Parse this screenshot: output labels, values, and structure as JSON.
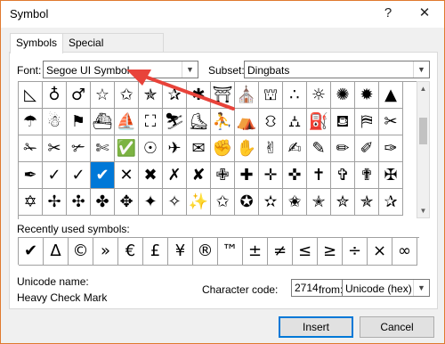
{
  "window": {
    "title": "Symbol",
    "help": "?",
    "close": "✕"
  },
  "tabs": [
    {
      "label": "Symbols",
      "active": true
    },
    {
      "label": "Special Characters",
      "active": false
    }
  ],
  "font": {
    "label": "Font:",
    "value": "Segoe UI Symbol"
  },
  "subset": {
    "label": "Subset:",
    "value": "Dingbats"
  },
  "symbols": [
    [
      "◺",
      "♁",
      "♂",
      "☆",
      "✩",
      "✯",
      "✰",
      "✱",
      "⛩",
      "⛪",
      "⛫",
      "∴",
      "☼",
      "✺",
      "✹",
      "▲"
    ],
    [
      "☂",
      "☃",
      "⚑",
      "⛴",
      "⛵",
      "⛶",
      "⛷",
      "⛸",
      "⛹",
      "⛺",
      "⛻",
      "⛼",
      "⛽",
      "⛾",
      "⛿",
      "✂"
    ],
    [
      "✁",
      "✂",
      "✃",
      "✄",
      "✅",
      "☉",
      "✈",
      "✉",
      "✊",
      "✋",
      "✌",
      "✍",
      "✎",
      "✏",
      "✐",
      "✑"
    ],
    [
      "✒",
      "✓",
      "✓",
      "✔",
      "✕",
      "✖",
      "✗",
      "✘",
      "✙",
      "✚",
      "✛",
      "✜",
      "✝",
      "✞",
      "✟",
      "✠"
    ],
    [
      "✡",
      "✢",
      "✣",
      "✤",
      "✥",
      "✦",
      "✧",
      "✨",
      "✩",
      "✪",
      "✫",
      "✬",
      "✭",
      "✮",
      "✯",
      "✰"
    ]
  ],
  "recent": {
    "label": "Recently used symbols:",
    "items": [
      "✔",
      "Δ",
      "©",
      "»",
      "€",
      "£",
      "¥",
      "®",
      "™",
      "±",
      "≠",
      "≤",
      "≥",
      "÷",
      "×",
      "∞"
    ]
  },
  "unicode": {
    "label": "Unicode name:",
    "name": "Heavy Check Mark"
  },
  "charcode": {
    "label": "Character code:",
    "value": "2714"
  },
  "from": {
    "label": "from:",
    "value": "Unicode (hex)"
  },
  "buttons": {
    "insert": "Insert",
    "cancel": "Cancel"
  },
  "colors": {
    "selection": "#0078d7",
    "accent_border": "#e07a2f",
    "annotation_arrow": "#e8433a"
  }
}
